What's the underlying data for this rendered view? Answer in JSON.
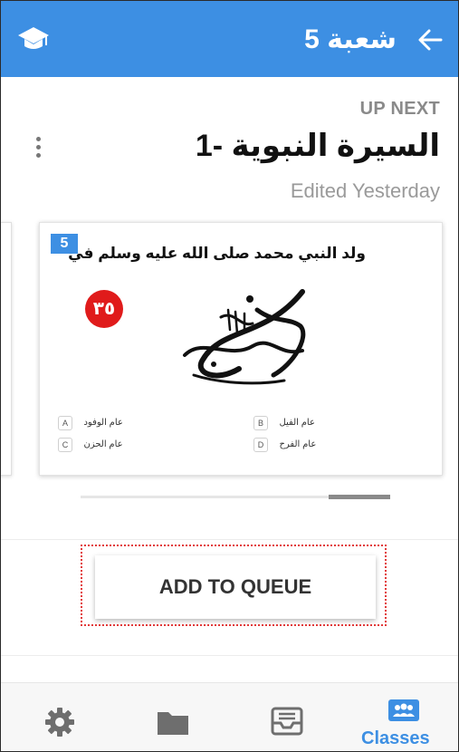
{
  "header": {
    "title": "شعبة 5",
    "icons": {
      "left": "graduation-cap-icon",
      "right": "arrow-back-icon"
    },
    "background": "#3d8fe3"
  },
  "up_next": {
    "label": "UP NEXT",
    "lesson_title": "السيرة النبوية -1",
    "edited": "Edited Yesterday",
    "menu_icon": "more-vert-icon"
  },
  "slide": {
    "number": "5",
    "question": "ولد النبي محمد صلى الله عليه وسلم في",
    "timer": "٣٥",
    "image": "muhammad-rasul-allah-calligraphy",
    "answers": [
      {
        "letter": "A",
        "text": "عام الوفود"
      },
      {
        "letter": "B",
        "text": "عام الفيل"
      },
      {
        "letter": "C",
        "text": "عام الحزن"
      },
      {
        "letter": "D",
        "text": "عام الفرح"
      }
    ]
  },
  "carousel": {
    "scroll_position": 0.8
  },
  "actions": {
    "add_to_queue": "ADD TO QUEUE"
  },
  "bottom_nav": {
    "items": [
      {
        "icon": "settings-icon"
      },
      {
        "icon": "folder-icon"
      },
      {
        "icon": "tray-icon"
      },
      {
        "icon": "people-icon",
        "label": "Classes",
        "active": true
      }
    ],
    "active_color": "#3d8fe3"
  }
}
